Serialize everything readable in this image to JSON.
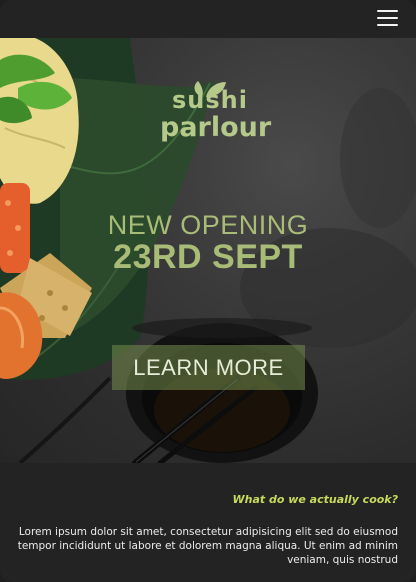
{
  "header": {
    "menu_icon": "hamburger-menu-icon"
  },
  "hero": {
    "logo_line1": "sushi",
    "logo_line2": "parlour",
    "headline": "NEW OPENING",
    "date": "23RD SEPT",
    "cta_label": "LEARN MORE"
  },
  "section": {
    "subheading": "What do we actually cook?",
    "body": "Lorem ipsum dolor sit amet, consectetur adipisicing elit sed do eiusmod tempor incididunt ut labore et dolorem magna aliqua. Ut enim ad minim veniam, quis nostrud"
  },
  "colors": {
    "accent_green": "#a8bb77",
    "subheading_yellow": "#c8da5a",
    "background": "#232323"
  }
}
